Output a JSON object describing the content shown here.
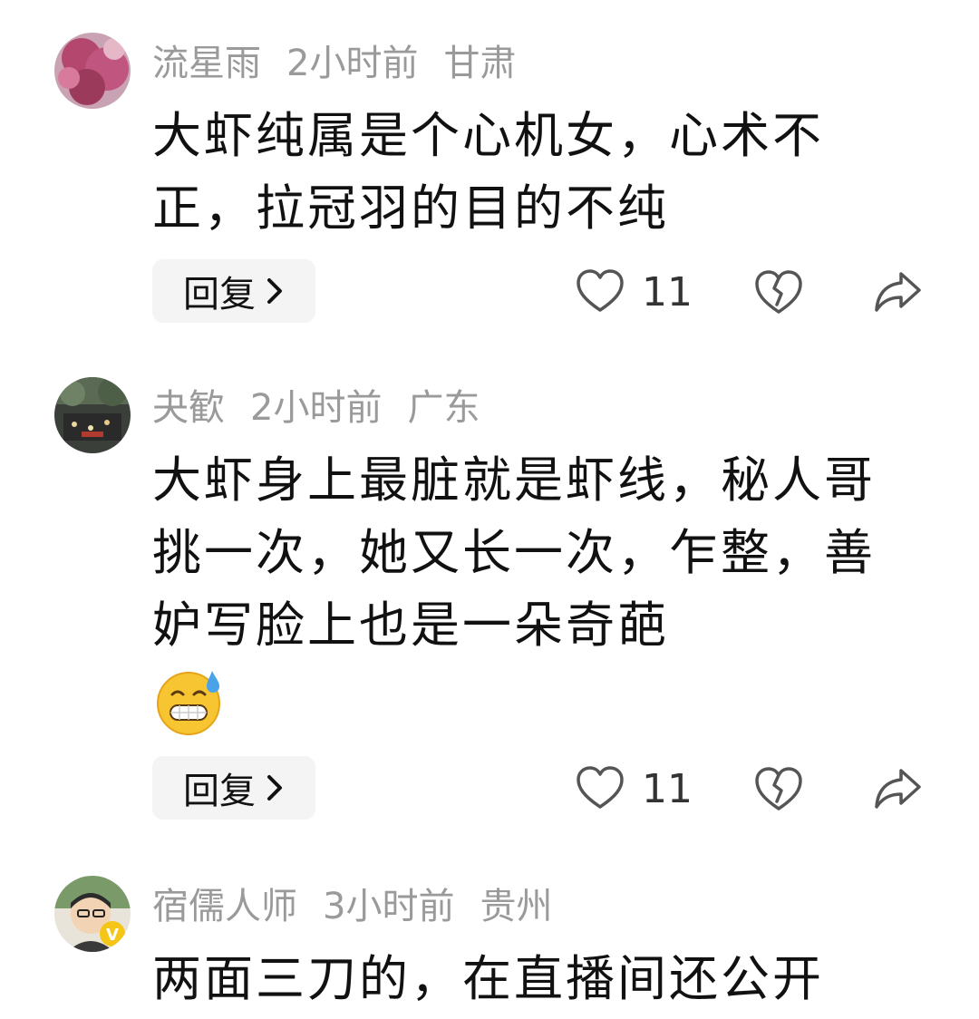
{
  "comments": [
    {
      "username": "流星雨",
      "time": "2小时前",
      "location": "甘肃",
      "text": "大虾纯属是个心机女，心术不正，拉冠羽的目的不纯",
      "reply_label": "回复",
      "like_count": "11"
    },
    {
      "username": "夬歓",
      "time": "2小时前",
      "location": "广东",
      "text": "大虾身上最脏就是虾线，秘人哥挑一次，她又长一次，乍整，善妒写脸上也是一朵奇葩",
      "emoji": "grinning-sweat-emoji",
      "reply_label": "回复",
      "like_count": "11"
    },
    {
      "username": "宿儒人师",
      "time": "3小时前",
      "location": "贵州",
      "text": "两面三刀的，在直播间还公开"
    }
  ],
  "colors": {
    "meta_gray": "#9a9a9a",
    "text": "#111111",
    "reply_bg": "#f4f4f4",
    "icon": "#555555",
    "verified_badge": "#f5c518"
  },
  "icons": [
    "heart-icon",
    "broken-heart-icon",
    "share-icon",
    "chevron-right-icon"
  ]
}
